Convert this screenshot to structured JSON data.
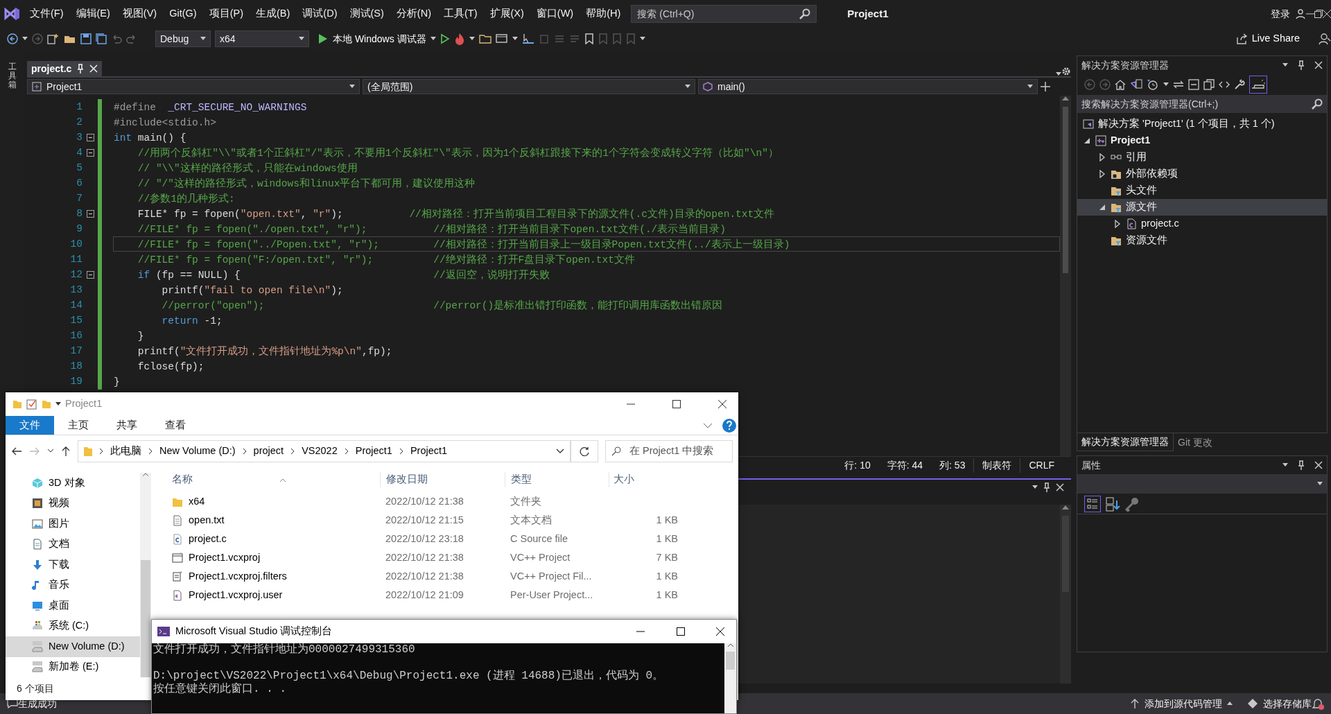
{
  "menu_bar": {
    "items": [
      "文件(F)",
      "编辑(E)",
      "视图(V)",
      "Git(G)",
      "项目(P)",
      "生成(B)",
      "调试(D)",
      "测试(S)",
      "分析(N)",
      "工具(T)",
      "扩展(X)",
      "窗口(W)",
      "帮助(H)"
    ],
    "search_placeholder": "搜索 (Ctrl+Q)",
    "title": "Project1",
    "sign_in": "登录"
  },
  "toolbar": {
    "configuration": "Debug",
    "platform": "x64",
    "debugger": "本地 Windows 调试器",
    "live_share": "Live Share"
  },
  "side_strip": {
    "label": "工具箱"
  },
  "editor": {
    "tab": {
      "label": "project.c",
      "selected": true
    },
    "nav": [
      "Project1",
      "(全局范围)",
      "main()"
    ],
    "lines": [
      {
        "number": "1",
        "foldable": false,
        "current": false,
        "tokens": [
          {
            "kind": "pp",
            "text": "#define  "
          },
          {
            "kind": "macro",
            "text": "_CRT_SECURE_NO_WARNINGS"
          }
        ]
      },
      {
        "number": "2",
        "foldable": false,
        "current": false,
        "tokens": [
          {
            "kind": "pp",
            "text": "#include<stdio.h>"
          }
        ]
      },
      {
        "number": "3",
        "foldable": true,
        "current": false,
        "tokens": [
          {
            "kind": "kw",
            "text": "int"
          },
          {
            "kind": "plain",
            "text": " main() {"
          }
        ]
      },
      {
        "number": "4",
        "foldable": true,
        "current": false,
        "tokens": [
          {
            "kind": "comment",
            "text": "    //用两个反斜杠\"\\\\\"或者1个正斜杠\"/\"表示，不要用1个反斜杠\"\\\"表示，因为1个反斜杠跟接下来的1个字符会变成转义字符（比如\"\\n\"）"
          }
        ]
      },
      {
        "number": "5",
        "foldable": false,
        "current": false,
        "tokens": [
          {
            "kind": "comment",
            "text": "    // \"\\\\\"这样的路径形式，只能在windows使用"
          }
        ]
      },
      {
        "number": "6",
        "foldable": false,
        "current": false,
        "tokens": [
          {
            "kind": "comment",
            "text": "    // \"/\"这样的路径形式，windows和linux平台下都可用，建议使用这种"
          }
        ]
      },
      {
        "number": "7",
        "foldable": false,
        "current": false,
        "tokens": [
          {
            "kind": "comment",
            "text": "    //参数1的几种形式:"
          }
        ]
      },
      {
        "number": "8",
        "foldable": true,
        "current": false,
        "tokens": [
          {
            "kind": "plain",
            "text": "    FILE* fp = fopen("
          },
          {
            "kind": "str",
            "text": "\"open.txt\""
          },
          {
            "kind": "plain",
            "text": ", "
          },
          {
            "kind": "str",
            "text": "\"r\""
          },
          {
            "kind": "plain",
            "text": ");"
          },
          {
            "kind": "comment",
            "text": "           //相对路径：打开当前项目工程目录下的源文件(.c文件)目录的open.txt文件"
          }
        ]
      },
      {
        "number": "9",
        "foldable": false,
        "current": false,
        "tokens": [
          {
            "kind": "comment",
            "text": "    //FILE* fp = fopen(\"./open.txt\", \"r\");           //相对路径：打开当前目录下open.txt文件(./表示当前目录)"
          }
        ]
      },
      {
        "number": "10",
        "foldable": false,
        "current": true,
        "tokens": [
          {
            "kind": "comment",
            "text": "    //FILE* fp = fopen(\"../Popen.txt\", \"r\");         //相对路径：打开当前目录上一级目录Popen.txt文件(../表示上一级目录)"
          }
        ]
      },
      {
        "number": "11",
        "foldable": false,
        "current": false,
        "tokens": [
          {
            "kind": "comment",
            "text": "    //FILE* fp = fopen(\"F:/open.txt\", \"r\");          //绝对路径：打开F盘目录下open.txt文件"
          }
        ]
      },
      {
        "number": "12",
        "foldable": true,
        "current": false,
        "tokens": [
          {
            "kind": "kw",
            "text": "    if"
          },
          {
            "kind": "plain",
            "text": " (fp == NULL) {"
          },
          {
            "kind": "comment",
            "text": "                                //返回空，说明打开失败"
          }
        ]
      },
      {
        "number": "13",
        "foldable": false,
        "current": false,
        "tokens": [
          {
            "kind": "plain",
            "text": "        printf("
          },
          {
            "kind": "str",
            "text": "\"fail to open file\\n\""
          },
          {
            "kind": "plain",
            "text": ");"
          }
        ]
      },
      {
        "number": "14",
        "foldable": false,
        "current": false,
        "tokens": [
          {
            "kind": "comment",
            "text": "        //perror(\"open\");                            //perror()是标准出错打印函数，能打印调用库函数出错原因"
          }
        ]
      },
      {
        "number": "15",
        "foldable": false,
        "current": false,
        "tokens": [
          {
            "kind": "kw",
            "text": "        return"
          },
          {
            "kind": "plain",
            "text": " -1;"
          }
        ]
      },
      {
        "number": "16",
        "foldable": false,
        "current": false,
        "tokens": [
          {
            "kind": "plain",
            "text": "    }"
          }
        ]
      },
      {
        "number": "17",
        "foldable": false,
        "current": false,
        "tokens": [
          {
            "kind": "plain",
            "text": "    printf("
          },
          {
            "kind": "str",
            "text": "\"文件打开成功，文件指针地址为%p\\n\""
          },
          {
            "kind": "plain",
            "text": ",fp);"
          }
        ]
      },
      {
        "number": "18",
        "foldable": false,
        "current": false,
        "tokens": [
          {
            "kind": "plain",
            "text": "    fclose(fp);"
          }
        ]
      },
      {
        "number": "19",
        "foldable": false,
        "current": false,
        "tokens": [
          {
            "kind": "plain",
            "text": "}"
          }
        ]
      }
    ],
    "status": {
      "line": "行: 10",
      "char": "字符: 44",
      "col": "列: 53",
      "indent": "制表符",
      "eol": "CRLF"
    }
  },
  "solution_explorer": {
    "title": "解决方案资源管理器",
    "search_placeholder": "搜索解决方案资源管理器(Ctrl+;)",
    "tree": [
      {
        "label": "解决方案 'Project1' (1 个项目，共 1 个)",
        "kind": "solution",
        "selected": false,
        "children": [
          {
            "label": "Project1",
            "kind": "project",
            "expanded": true,
            "selected": false,
            "children": [
              {
                "label": "引用",
                "kind": "references",
                "expanded": false,
                "selected": false
              },
              {
                "label": "外部依赖项",
                "kind": "external",
                "expanded": false,
                "selected": false
              },
              {
                "label": "头文件",
                "kind": "filter",
                "selected": false
              },
              {
                "label": "源文件",
                "kind": "filter",
                "expanded": true,
                "selected": true,
                "children": [
                  {
                    "label": "project.c",
                    "kind": "cfile",
                    "expanded": false,
                    "selected": false
                  }
                ]
              },
              {
                "label": "资源文件",
                "kind": "filter",
                "selected": false
              }
            ]
          }
        ]
      }
    ],
    "tabs": [
      {
        "label": "解决方案资源管理器",
        "selected": true
      },
      {
        "label": "Git 更改",
        "selected": false
      }
    ]
  },
  "properties": {
    "title": "属性"
  },
  "status_bar": {
    "message": "生成成功",
    "source_control": "添加到源代码管理",
    "repository": "选择存储库"
  },
  "file_explorer": {
    "title": "Project1",
    "ribbon_tabs": [
      {
        "label": "文件",
        "selected": true
      },
      {
        "label": "主页",
        "selected": false
      },
      {
        "label": "共享",
        "selected": false
      },
      {
        "label": "查看",
        "selected": false
      }
    ],
    "breadcrumb": [
      "此电脑",
      "New Volume (D:)",
      "project",
      "VS2022",
      "Project1",
      "Project1"
    ],
    "search_placeholder": "在 Project1 中搜索",
    "nav_items": [
      {
        "label": "3D 对象",
        "kind": "cube",
        "selected": false
      },
      {
        "label": "视频",
        "kind": "video",
        "selected": false
      },
      {
        "label": "图片",
        "kind": "image",
        "selected": false
      },
      {
        "label": "文档",
        "kind": "document",
        "selected": false
      },
      {
        "label": "下载",
        "kind": "download",
        "selected": false
      },
      {
        "label": "音乐",
        "kind": "music",
        "selected": false
      },
      {
        "label": "桌面",
        "kind": "desktop",
        "selected": false
      },
      {
        "label": "系统 (C:)",
        "kind": "system-drive",
        "selected": false
      },
      {
        "label": "New Volume (D:)",
        "kind": "drive",
        "selected": true
      },
      {
        "label": "新加卷 (E:)",
        "kind": "drive",
        "selected": false
      }
    ],
    "columns": [
      "名称",
      "修改日期",
      "类型",
      "大小"
    ],
    "rows": [
      {
        "name": "x64",
        "date": "2022/10/12 21:38",
        "type": "文件夹",
        "kind": "folder"
      },
      {
        "name": "open.txt",
        "date": "2022/10/12 21:15",
        "type": "文本文档",
        "size": "1 KB",
        "kind": "text"
      },
      {
        "name": "project.c",
        "date": "2022/10/12 23:18",
        "type": "C Source file",
        "size": "1 KB",
        "kind": "c"
      },
      {
        "name": "Project1.vcxproj",
        "date": "2022/10/12 21:38",
        "type": "VC++ Project",
        "size": "7 KB",
        "kind": "project"
      },
      {
        "name": "Project1.vcxproj.filters",
        "date": "2022/10/12 21:38",
        "type": "VC++ Project Fil...",
        "size": "1 KB",
        "kind": "filters"
      },
      {
        "name": "Project1.vcxproj.user",
        "date": "2022/10/12 21:09",
        "type": "Per-User Project...",
        "size": "1 KB",
        "kind": "user"
      }
    ],
    "item_count": "6 个项目"
  },
  "console": {
    "title": "Microsoft Visual Studio 调试控制台",
    "paragraphs": [
      [
        "文件打开成功，文件指针地址为0000027499315360"
      ],
      [
        "D:\\project\\VS2022\\Project1\\x64\\Debug\\Project1.exe (进程 14688)已退出，代码为 0。",
        "按任意键关闭此窗口. . ."
      ]
    ]
  }
}
